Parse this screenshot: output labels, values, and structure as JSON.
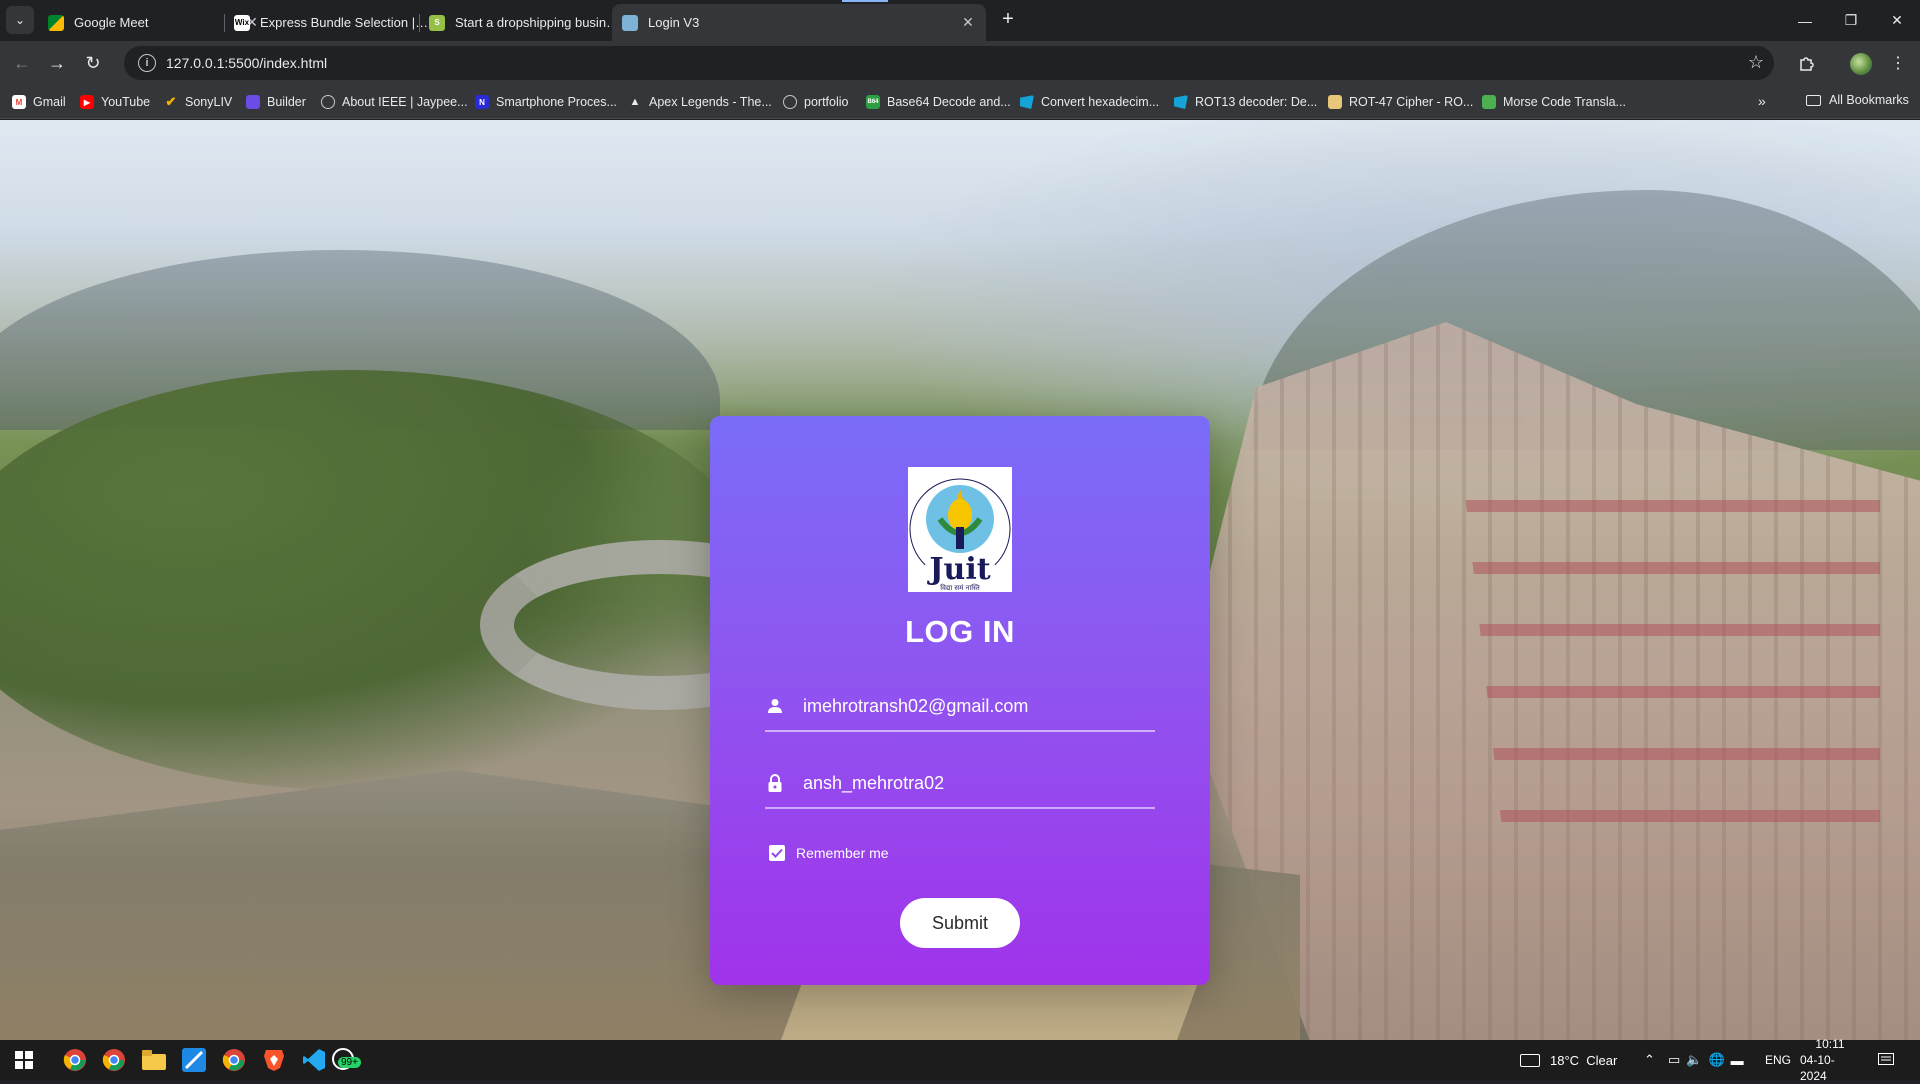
{
  "browser": {
    "tabs": [
      {
        "title": "Google Meet",
        "active": false
      },
      {
        "title": "Express Bundle Selection | Wix.c",
        "active": false
      },
      {
        "title": "Start a dropshipping business—",
        "active": false
      },
      {
        "title": "Login V3",
        "active": true
      }
    ],
    "url": "127.0.0.1:5500/index.html",
    "bookmarks": [
      {
        "label": "Gmail",
        "icon": "gmail-icon",
        "color": "#ea4335"
      },
      {
        "label": "YouTube",
        "icon": "youtube-icon",
        "color": "#ff0000"
      },
      {
        "label": "SonyLIV",
        "icon": "sonyliv-icon",
        "color": "#f5b301"
      },
      {
        "label": "Builder",
        "icon": "builder-icon",
        "color": "#6b4ce6"
      },
      {
        "label": "About IEEE | Jaypee...",
        "icon": "globe-icon",
        "color": "#9aa0a6"
      },
      {
        "label": "Smartphone Proces...",
        "icon": "notion-icon",
        "color": "#2b2bd6"
      },
      {
        "label": "Apex Legends - The...",
        "icon": "apex-icon",
        "color": "#bdbdbd"
      },
      {
        "label": "portfolio",
        "icon": "globe-icon",
        "color": "#9aa0a6"
      },
      {
        "label": "Base64 Decode and...",
        "icon": "base64-icon",
        "color": "#2e9e44"
      },
      {
        "label": "Convert hexadecim...",
        "icon": "convert-icon",
        "color": "#16a3d8"
      },
      {
        "label": "ROT13 decoder: De...",
        "icon": "rot13-icon",
        "color": "#16a3d8"
      },
      {
        "label": "ROT-47 Cipher - RO...",
        "icon": "rot47-icon",
        "color": "#e8c77a"
      },
      {
        "label": "Morse Code Transla...",
        "icon": "morse-icon",
        "color": "#4caf50"
      }
    ],
    "all_bookmarks": "All Bookmarks"
  },
  "login": {
    "heading": "LOG IN",
    "email_value": "imehrotransh02@gmail.com",
    "password_value": "ansh_mehrotra02",
    "remember_label": "Remember me",
    "remember_checked": true,
    "submit_label": "Submit",
    "logo_text": "Juit",
    "logo_ring_text": "JAYPEE UNIVERSITY OF INFORMATION TECHNOLOGY",
    "logo_motto": "विद्या समं नास्ति"
  },
  "taskbar": {
    "weather": "18°C  Clear",
    "lang": "ENG",
    "time": "10:11",
    "date": "04-10-2024",
    "whatsapp_badge": "99+"
  },
  "colors": {
    "card_top": "#7a6cf9",
    "card_bottom": "#a033ea"
  }
}
